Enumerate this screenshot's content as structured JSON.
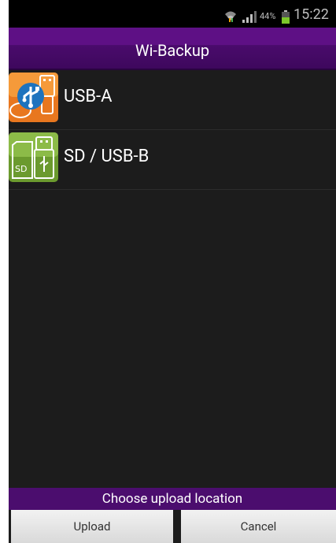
{
  "status_bar": {
    "battery_percent": "44%",
    "time": "15:22",
    "wifi_icon": "wifi-icon",
    "signal_icon": "signal-icon",
    "battery_icon": "battery-icon"
  },
  "app": {
    "title": "Wi-Backup"
  },
  "locations": [
    {
      "label": "USB-A",
      "icon": "usb-a-icon",
      "color": "#e8771f"
    },
    {
      "label": "SD / USB-B",
      "icon": "sd-usb-b-icon",
      "color": "#6b9a2e"
    }
  ],
  "footer": {
    "prompt": "Choose upload location",
    "upload_label": "Upload",
    "cancel_label": "Cancel"
  },
  "colors": {
    "accent": "#5e1085",
    "background": "#1c1c1c"
  }
}
